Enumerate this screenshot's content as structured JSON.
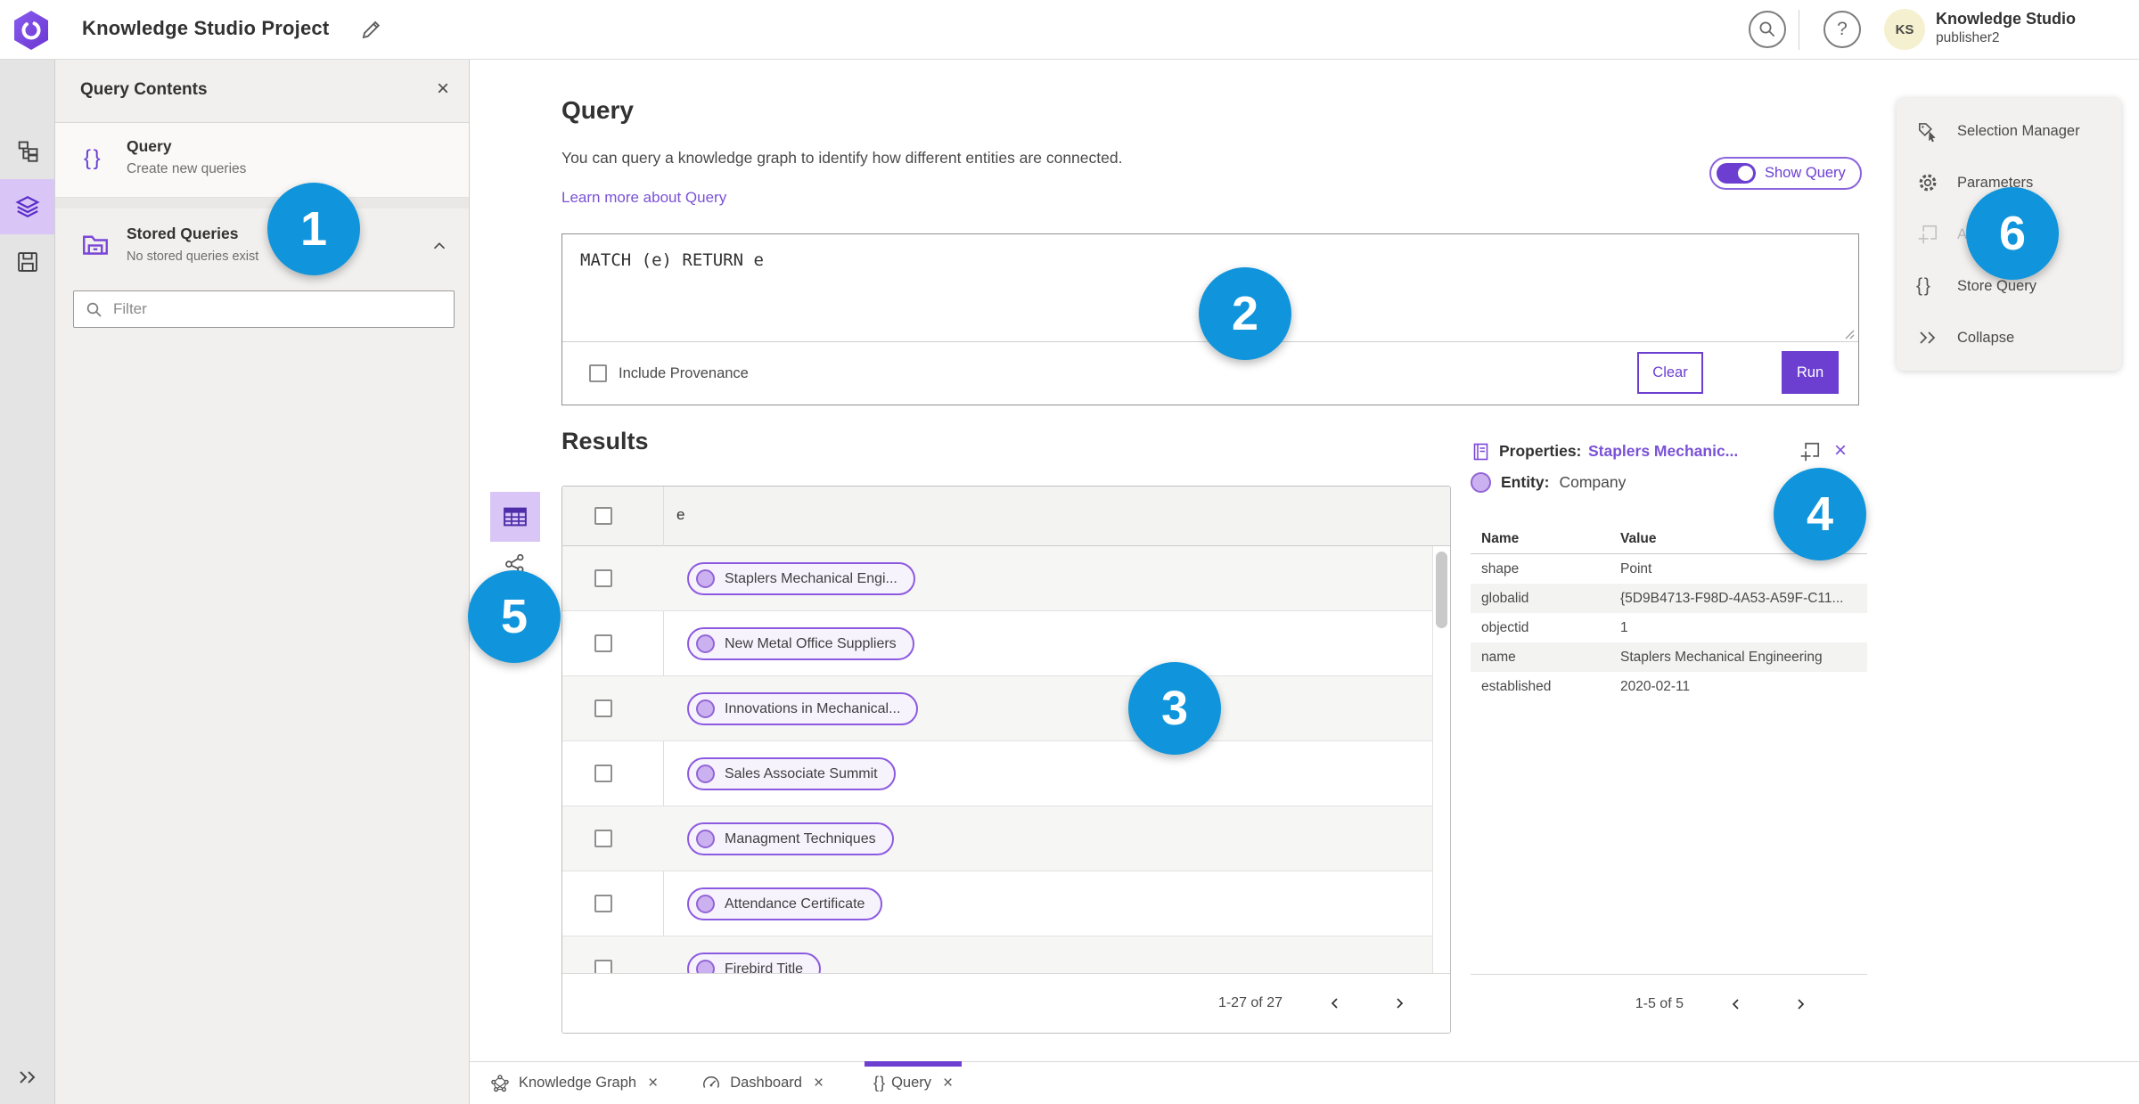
{
  "colors": {
    "accent_purple": "#6C3FD1",
    "accent_light_purple": "#D9C6F7",
    "link_purple": "#7A52D6",
    "pill_border": "#8C5AE0",
    "pill_fill": "#F7F3FD",
    "badge_blue": "#1095DC"
  },
  "icons_map": {
    "close": "×",
    "help": "?",
    "collapse": "»",
    "braces": "{ }"
  },
  "topbar": {
    "title": "Knowledge Studio Project",
    "avatar_initials": "KS",
    "user_name": "Knowledge Studio",
    "user_role": "publisher2"
  },
  "contents_panel": {
    "title": "Query Contents",
    "query_item": {
      "title": "Query",
      "subtitle": "Create new queries"
    },
    "stored_queries": {
      "title": "Stored Queries",
      "subtitle": "No stored queries exist"
    },
    "filter_placeholder": "Filter"
  },
  "query_section": {
    "title": "Query",
    "description": "You can query a knowledge graph to identify how different entities are connected.",
    "learn_more": "Learn more about Query",
    "show_query_label": "Show Query",
    "query_text": "MATCH (e) RETURN e",
    "include_provenance_label": "Include Provenance",
    "clear_label": "Clear",
    "run_label": "Run"
  },
  "results": {
    "title": "Results",
    "column_header": "e",
    "rows": [
      {
        "label": "Staplers Mechanical Engi..."
      },
      {
        "label": "New Metal Office Suppliers"
      },
      {
        "label": "Innovations in Mechanical..."
      },
      {
        "label": "Sales Associate Summit"
      },
      {
        "label": "Managment Techniques"
      },
      {
        "label": "Attendance Certificate"
      },
      {
        "label": "Firebird Title"
      }
    ],
    "pagination": "1-27 of 27"
  },
  "properties": {
    "title_label": "Properties:",
    "title_link": "Staplers Mechanic...",
    "entity_label": "Entity:",
    "entity_value": "Company",
    "headers": [
      "Name",
      "Value"
    ],
    "rows": [
      [
        "shape",
        "Point"
      ],
      [
        "globalid",
        "{5D9B4713-F98D-4A53-A59F-C11..."
      ],
      [
        "objectid",
        "1"
      ],
      [
        "name",
        "Staplers Mechanical Engineering"
      ],
      [
        "established",
        "2020-02-11"
      ]
    ],
    "pagination": "1-5 of 5"
  },
  "right_menu": {
    "items": [
      {
        "label": "Selection Manager"
      },
      {
        "label": "Parameters"
      },
      {
        "label": "Add To Map"
      },
      {
        "label": "Store Query"
      },
      {
        "label": "Collapse"
      }
    ]
  },
  "tabs": [
    {
      "label": "Knowledge Graph"
    },
    {
      "label": "Dashboard"
    },
    {
      "label": "Query"
    }
  ],
  "badges": [
    "1",
    "2",
    "3",
    "4",
    "5",
    "6"
  ]
}
